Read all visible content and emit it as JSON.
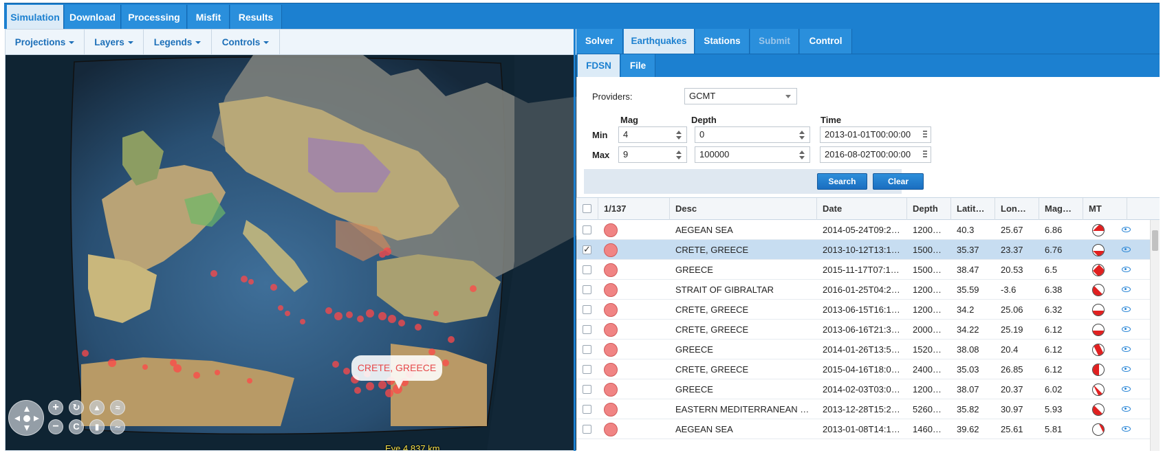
{
  "top_nav": {
    "tabs": [
      {
        "label": "Simulation",
        "active": true
      },
      {
        "label": "Download",
        "active": false
      },
      {
        "label": "Processing",
        "active": false
      },
      {
        "label": "Misfit",
        "active": false
      },
      {
        "label": "Results",
        "active": false
      }
    ]
  },
  "map_menu": {
    "items": [
      "Projections",
      "Layers",
      "Legends",
      "Controls"
    ]
  },
  "map": {
    "tooltip": "CRETE, GREECE",
    "eye_readout": "Eye 4,837 km",
    "controls": [
      "pan-icon",
      "zoom-in-icon",
      "zoom-out-icon",
      "rotate-left-icon",
      "reset-heading-icon",
      "tilt-up-icon",
      "tilt-down-icon",
      "elevation-up-icon",
      "elevation-down-icon"
    ]
  },
  "right_tabs": [
    {
      "label": "Solver",
      "state": "normal"
    },
    {
      "label": "Earthquakes",
      "state": "active"
    },
    {
      "label": "Stations",
      "state": "normal"
    },
    {
      "label": "Submit",
      "state": "disabled"
    },
    {
      "label": "Control",
      "state": "normal"
    }
  ],
  "sub_tabs": [
    {
      "label": "FDSN",
      "active": true
    },
    {
      "label": "File",
      "active": false
    }
  ],
  "search_form": {
    "providers_label": "Providers:",
    "provider_value": "GCMT",
    "col_mag": "Mag",
    "col_depth": "Depth",
    "col_time": "Time",
    "row_min": "Min",
    "row_max": "Max",
    "min_mag": "4",
    "max_mag": "9",
    "min_depth": "0",
    "max_depth": "100000",
    "min_time": "2013-01-01T00:00:00",
    "max_time": "2016-08-02T00:00:00",
    "search_label": "Search",
    "clear_label": "Clear"
  },
  "grid": {
    "selection_count": "1/137",
    "columns": [
      "Desc",
      "Date",
      "Depth",
      "Latit…",
      "Lon…",
      "Mag…",
      "MT"
    ],
    "rows": [
      {
        "desc": "AEGEAN SEA",
        "date": "2014-05-24T09:2…",
        "depth": "1200…",
        "lat": "40.3",
        "lon": "25.67",
        "mag": "6.86",
        "checked": false,
        "selected": false
      },
      {
        "desc": "CRETE, GREECE",
        "date": "2013-10-12T13:1…",
        "depth": "1500…",
        "lat": "35.37",
        "lon": "23.37",
        "mag": "6.76",
        "checked": true,
        "selected": true
      },
      {
        "desc": "GREECE",
        "date": "2015-11-17T07:1…",
        "depth": "1500…",
        "lat": "38.47",
        "lon": "20.53",
        "mag": "6.5",
        "checked": false,
        "selected": false
      },
      {
        "desc": "STRAIT OF GIBRALTAR",
        "date": "2016-01-25T04:2…",
        "depth": "1200…",
        "lat": "35.59",
        "lon": "-3.6",
        "mag": "6.38",
        "checked": false,
        "selected": false
      },
      {
        "desc": "CRETE, GREECE",
        "date": "2013-06-15T16:1…",
        "depth": "1200…",
        "lat": "34.2",
        "lon": "25.06",
        "mag": "6.32",
        "checked": false,
        "selected": false
      },
      {
        "desc": "CRETE, GREECE",
        "date": "2013-06-16T21:3…",
        "depth": "2000…",
        "lat": "34.22",
        "lon": "25.19",
        "mag": "6.12",
        "checked": false,
        "selected": false
      },
      {
        "desc": "GREECE",
        "date": "2014-01-26T13:5…",
        "depth": "1520…",
        "lat": "38.08",
        "lon": "20.4",
        "mag": "6.12",
        "checked": false,
        "selected": false
      },
      {
        "desc": "CRETE, GREECE",
        "date": "2015-04-16T18:0…",
        "depth": "2400…",
        "lat": "35.03",
        "lon": "26.85",
        "mag": "6.12",
        "checked": false,
        "selected": false
      },
      {
        "desc": "GREECE",
        "date": "2014-02-03T03:0…",
        "depth": "1200…",
        "lat": "38.07",
        "lon": "20.37",
        "mag": "6.02",
        "checked": false,
        "selected": false
      },
      {
        "desc": "EASTERN MEDITERRANEAN …",
        "date": "2013-12-28T15:2…",
        "depth": "5260…",
        "lat": "35.82",
        "lon": "30.97",
        "mag": "5.93",
        "checked": false,
        "selected": false
      },
      {
        "desc": "AEGEAN SEA",
        "date": "2013-01-08T14:1…",
        "depth": "1460…",
        "lat": "39.62",
        "lon": "25.61",
        "mag": "5.81",
        "checked": false,
        "selected": false
      }
    ]
  },
  "colors": {
    "accent": "#1c80d0",
    "active_tab_bg": "#dcebf7",
    "selected_row": "#c7ddf1",
    "event_marker": "#f08484",
    "tooltip_text": "#e6484a"
  }
}
